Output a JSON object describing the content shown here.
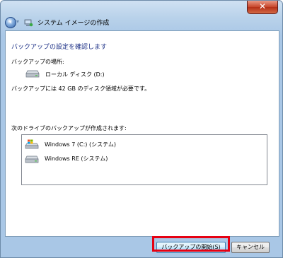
{
  "window": {
    "title": "システム イメージの作成",
    "close_label": "✕"
  },
  "content": {
    "heading": "バックアップの設定を確認します",
    "location_label": "バックアップの場所:",
    "drive": "ローカル ディスク (D:)",
    "space_required": "バックアップには 42 GB のディスク領域が必要です。",
    "list_label": "次のドライブのバックアップが作成されます:",
    "drives": [
      {
        "label": "Windows 7 (C:) (システム)",
        "icon": "windows-drive-icon"
      },
      {
        "label": "Windows RE (システム)",
        "icon": "hard-drive-icon"
      }
    ]
  },
  "buttons": {
    "start": "バックアップの開始(S)",
    "cancel": "キャンセル"
  },
  "colors": {
    "heading": "#1e3287",
    "highlight": "#e60012"
  }
}
